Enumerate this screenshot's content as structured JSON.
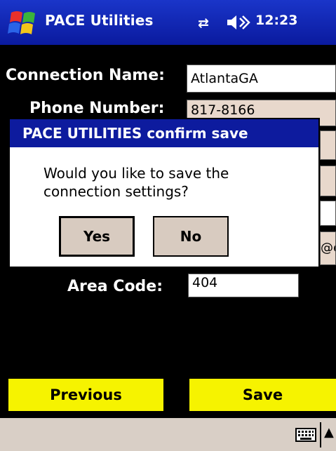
{
  "titlebar": {
    "app_name": "PACE Utilities",
    "time": "12:23",
    "icons": [
      "windows-start-flag",
      "connectivity-arrows",
      "speaker-volume"
    ]
  },
  "form": {
    "connection_name": {
      "label": "Connection Name:",
      "value": "AtlantaGA"
    },
    "phone_number": {
      "label": "Phone Number:",
      "value": "817-8166"
    },
    "email_partial": "@e",
    "area_code": {
      "label": "Area Code:",
      "value": "404"
    }
  },
  "dialog": {
    "title": "PACE UTILITIES confirm save",
    "message": "Would you like to save the connection settings?",
    "yes_label": "Yes",
    "no_label": "No"
  },
  "buttons": {
    "previous_label": "Previous",
    "save_label": "Save"
  },
  "colors": {
    "titlebar_blue": "#0d1b9e",
    "button_yellow": "#f6f300",
    "menubar_beige": "#d9cfc6",
    "dialog_button": "#d8cbc0"
  }
}
